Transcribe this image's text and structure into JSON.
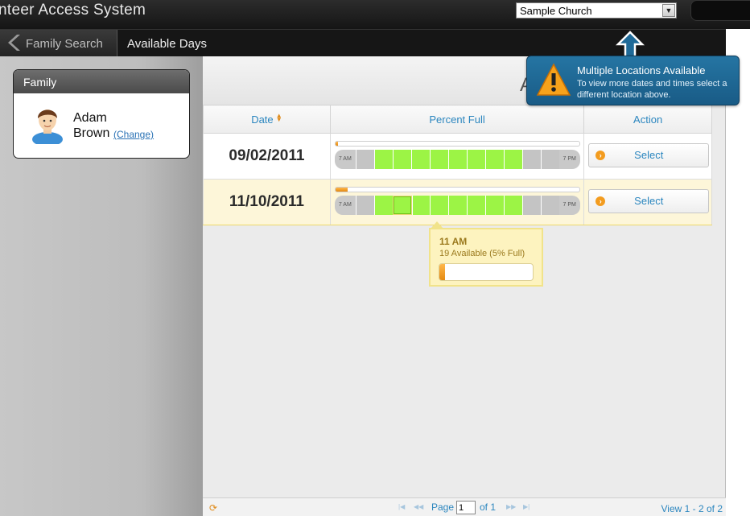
{
  "app": {
    "title": "nteer Access System"
  },
  "location": {
    "selected": "Sample Church"
  },
  "nav": {
    "back_label": "Family Search",
    "current": "Available Days"
  },
  "family": {
    "header": "Family",
    "first_name": "Adam",
    "last_name": "Brown",
    "change_label": "(Change)"
  },
  "main": {
    "header_text": "A"
  },
  "table": {
    "headers": {
      "date": "Date",
      "percent": "Percent Full",
      "action": "Action"
    },
    "rows": [
      {
        "date": "09/02/2011",
        "percent_full": 0.01,
        "start_label": "7 AM",
        "end_label": "7 PM",
        "slots": [
          false,
          true,
          true,
          true,
          true,
          true,
          true,
          true,
          true,
          false,
          false
        ],
        "action": "Select"
      },
      {
        "date": "11/10/2011",
        "percent_full": 0.05,
        "start_label": "7 AM",
        "end_label": "7 PM",
        "slots": [
          false,
          true,
          true,
          true,
          true,
          true,
          true,
          true,
          true,
          false,
          false
        ],
        "action": "Select"
      }
    ]
  },
  "tooltip": {
    "time": "11 AM",
    "availability": "19 Available (5% Full)",
    "fill": 0.05
  },
  "callout": {
    "title": "Multiple Locations Available",
    "message": "To view more dates and times select a different location above."
  },
  "footer": {
    "page_label": "Page",
    "page_value": "1",
    "page_of": "of 1",
    "view_count": "View 1 - 2 of 2"
  },
  "colors": {
    "accent": "#2b86bf",
    "available": "#9cf445",
    "fill": "#f39c1f",
    "callout": "#1f6a98"
  },
  "icons": {
    "back": "chevron-left-icon",
    "avatar": "user-avatar-icon",
    "sort": "sort-icon",
    "select": "arrow-right-circle-icon",
    "warning": "warning-icon",
    "refresh": "refresh-icon"
  }
}
